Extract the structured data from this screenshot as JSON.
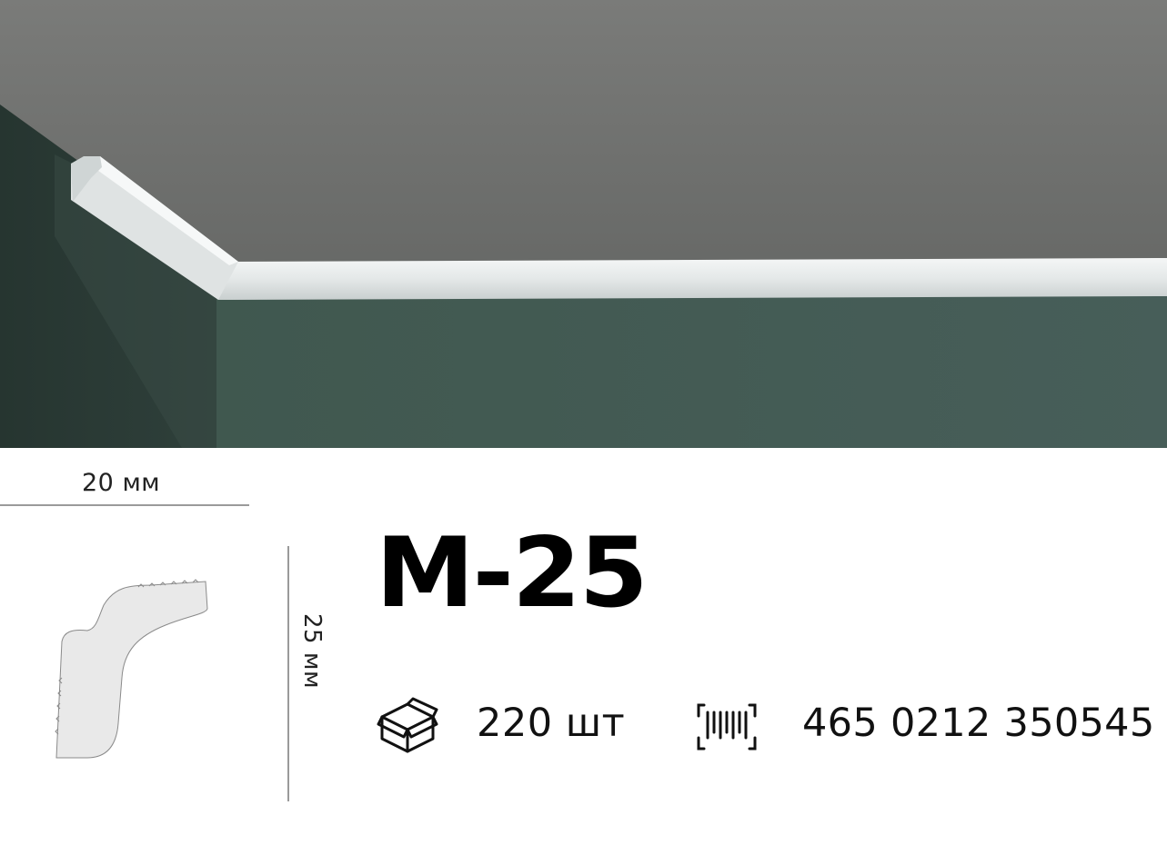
{
  "photo": {
    "icon": "ceiling-molding-photo"
  },
  "dimensions": {
    "width": "20 мм",
    "height": "25 мм"
  },
  "product": {
    "name": "М-25"
  },
  "package": {
    "icon": "box-icon",
    "quantity": "220 шт"
  },
  "barcode": {
    "icon": "barcode-icon",
    "value": "465 0212 350545"
  },
  "colors": {
    "ceiling": "#6b6d6b",
    "wall": "#435b56",
    "molding": "#e9ecec",
    "profile": "#e9e9e9"
  }
}
